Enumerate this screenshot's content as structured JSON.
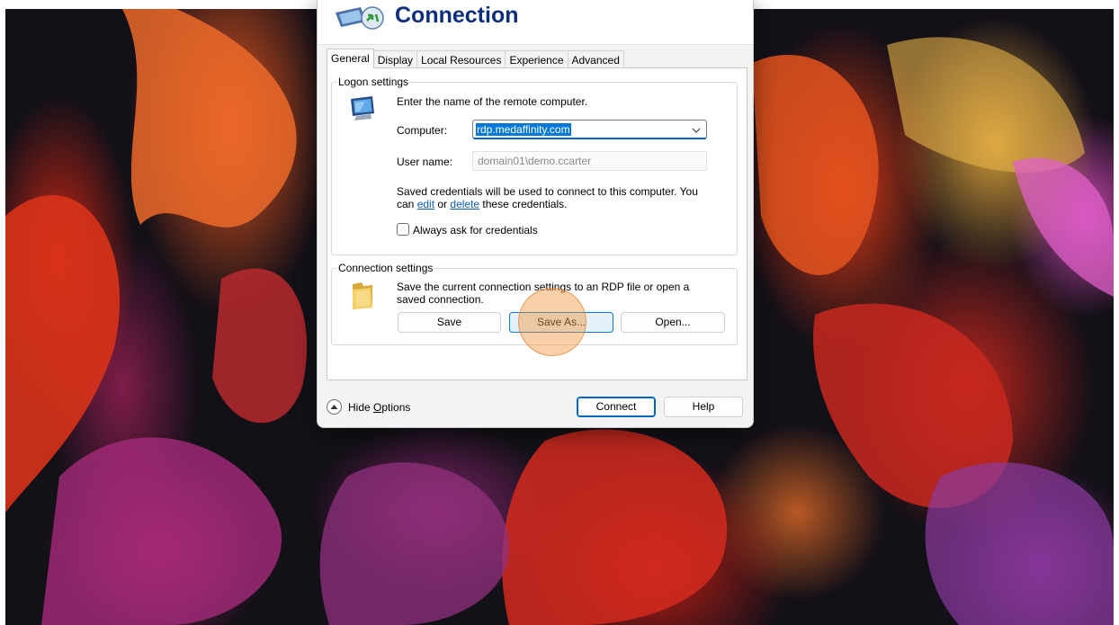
{
  "dialog": {
    "title": "Connection",
    "icon": "remote-desktop-icon",
    "tabs": [
      {
        "label": "General",
        "active": true
      },
      {
        "label": "Display",
        "active": false
      },
      {
        "label": "Local Resources",
        "active": false
      },
      {
        "label": "Experience",
        "active": false
      },
      {
        "label": "Advanced",
        "active": false
      }
    ]
  },
  "logon": {
    "group_title": "Logon settings",
    "prompt": "Enter the name of the remote computer.",
    "computer_label": "Computer:",
    "computer_value": "rdp.medaffinity.com",
    "username_label": "User name:",
    "username_value": "domain01\\demo.ccarter",
    "credentials_text_1": "Saved credentials will be used to connect to this computer.  You",
    "credentials_text_2a": "can ",
    "edit_link": "edit",
    "credentials_text_2b": " or ",
    "delete_link": "delete",
    "credentials_text_2c": " these credentials.",
    "always_ask_label": "Always ask for credentials",
    "always_ask_checked": false
  },
  "connection": {
    "group_title": "Connection settings",
    "text_1": "Save the current connection settings to an RDP file or open a",
    "text_2": "saved connection.",
    "save_label": "Save",
    "save_as_label": "Save As...",
    "open_label": "Open..."
  },
  "footer": {
    "hide_options_prefix": "Hide ",
    "hide_options_accel": "O",
    "hide_options_suffix": "ptions",
    "connect_label": "Connect",
    "help_label": "Help"
  },
  "colors": {
    "accent": "#0078d7",
    "title_blue": "#0c2f7d",
    "link": "#0b5cbb",
    "click_marker": "#f0963c"
  }
}
